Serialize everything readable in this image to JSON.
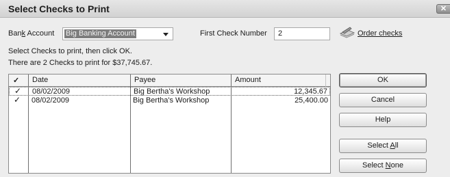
{
  "window": {
    "title": "Select Checks to Print",
    "close_glyph": "✕"
  },
  "bank_account": {
    "label_pre": "Ban",
    "label_mnemonic": "k",
    "label_post": " Account",
    "value": "Big Banking Account"
  },
  "first_check": {
    "label": "First Check Number",
    "value": "2"
  },
  "order_checks": {
    "icon": "checkbook-pen-icon",
    "label": "Order checks"
  },
  "instructions": {
    "line1": "Select Checks to print, then click OK.",
    "line2": "There are 2 Checks to print for $37,745.67."
  },
  "table": {
    "headers": {
      "check": "✓",
      "date": "Date",
      "payee": "Payee",
      "amount": "Amount"
    },
    "rows": [
      {
        "checked": "✓",
        "date": "08/02/2009",
        "payee": "Big Bertha's Workshop",
        "amount": "12,345.67"
      },
      {
        "checked": "✓",
        "date": "08/02/2009",
        "payee": "Big Bertha's Workshop",
        "amount": "25,400.00"
      }
    ]
  },
  "buttons": {
    "ok": "OK",
    "cancel": "Cancel",
    "help": "Help",
    "select_all_pre": "Select ",
    "select_all_mnemonic": "A",
    "select_all_post": "ll",
    "select_none_pre": "Select ",
    "select_none_mnemonic": "N",
    "select_none_post": "one"
  }
}
